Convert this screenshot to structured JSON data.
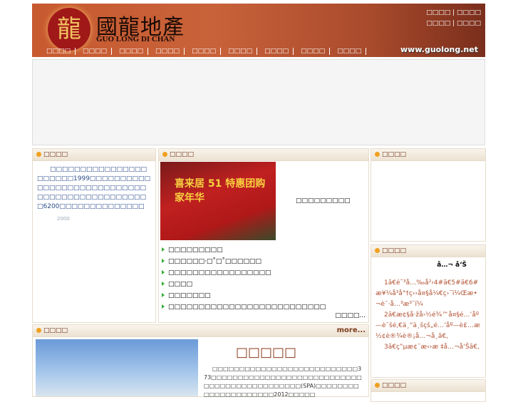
{
  "header": {
    "logo_glyph": "龍",
    "logo_cn": "國龍地產",
    "logo_en": "GUO LONG DI CHAN",
    "url": "www.guolong.net",
    "top_links": [
      "□□□□",
      "□□□□",
      "□□□□",
      "□□□□"
    ],
    "nav": [
      "□□□□",
      "□□□□",
      "□□□□",
      "□□□□",
      "□□□□",
      "□□□□",
      "□□□□",
      "□□□□",
      "□□□□"
    ]
  },
  "intro": {
    "title": "□□□□",
    "text": "□□□□□□□□□□□□□□□□□□□□□□1999□□□□□□□□□□□□□□□□□□□□□□□□□□□□□□□□□□□□□□□□□□□□□□□6200□□□□□□□□□□□□□□",
    "faint": "2000"
  },
  "news": {
    "title": "□□□□",
    "image_caption": "喜来居 51 特惠团购家年华",
    "featured": "□□□□□□□□□",
    "items": [
      "□□□□□□□□□",
      "□□□□□□·□˚□˚□□□□□□",
      "□□□□□□□□□□□□□□□□□",
      "□□□□",
      "□□□□□□□",
      "□□□□□□□□□□□□□□□□□□□□□□□□□□"
    ],
    "more": "□□□□..."
  },
  "right1": {
    "title": "□□□□"
  },
  "right2": {
    "title": "□□□□",
    "heading": "å…¬ å‘Š",
    "lines": [
      "1ã€é˜³å…‰å²›4#ã€5#ã€6#æ¥¼å³å°†ç››å¤§å¼€ç›˜ï¼Œæ•¬è¯·å…³æ³¨ï¼",
      "2ã€æ¢§å·žå›½é¾™å¤§é…’åº—è¯šé‚€ä¸“ä¸šçš„é…’åº—è£…æ½¢è®¾è®¡å…¬å¸ã€‚",
      "3ã€ç”µæ¢¯æ‹›æ ‡å…¬å‘Šã€‚"
    ]
  },
  "right3": {
    "title": "□□□□"
  },
  "project": {
    "title": "□□□□",
    "more": "more...",
    "name": "□□□□□",
    "text": "□□□□□□□□□□□□□□□□□□□□□□□□□□□373□□□□□□□□□□□□□□□□□□□□□□□□□□□□□□□□□□□□□□□□□□□□□□(SPA)□□□□□□□□□□□□□□□□□□□□□2012□□□□□"
  }
}
